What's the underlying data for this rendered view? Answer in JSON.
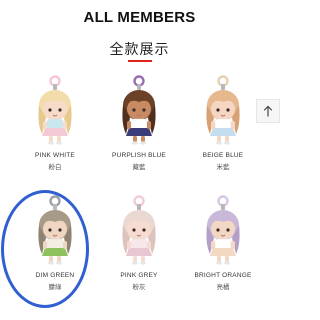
{
  "header": {
    "title": "ALL MEMBERS",
    "subtitle": "全款展示",
    "accent_color": "#e2231a"
  },
  "scroll_top": {
    "icon": "arrow-up-icon"
  },
  "members": [
    {
      "name": "PINK WHITE",
      "cn": "粉白",
      "hair": "#f2dca9",
      "hair_dark": "#e6c98d",
      "top": "#c9e7ee",
      "skirt": "#f4c9d6",
      "ring": "#f6c6d5",
      "skin": "#f6dcc8"
    },
    {
      "name": "PURPLISH BLUE",
      "cn": "藏藍",
      "hair": "#6b4128",
      "hair_dark": "#4f2e1b",
      "top": "#ffffff",
      "skirt": "#3b3d7a",
      "ring": "#9b6bb0",
      "skin": "#c88a62"
    },
    {
      "name": "BEIGE BLUE",
      "cn": "米藍",
      "hair": "#e6b88e",
      "hair_dark": "#d7a173",
      "top": "#ffffff",
      "skirt": "#c6dcef",
      "ring": "#e7d1b2",
      "skin": "#f4d6c2"
    },
    {
      "name": "DIM GREEN",
      "cn": "朦綠",
      "hair": "#a79a86",
      "hair_dark": "#8e8270",
      "top": "#f3efe0",
      "skirt": "#8fc25a",
      "ring": "#9aa0a6",
      "skin": "#efd6c2"
    },
    {
      "name": "PINK GREY",
      "cn": "粉灰",
      "hair": "#ead8d3",
      "hair_dark": "#dcc3bd",
      "top": "#f7e6ea",
      "skirt": "#e9c7d2",
      "ring": "#f2cbd6",
      "skin": "#f6dcd0"
    },
    {
      "name": "BRIGHT ORANGE",
      "cn": "亮橘",
      "hair": "#c9b8d8",
      "hair_dark": "#b3a0c6",
      "top": "#ffffff",
      "skirt": "#f3d9c2",
      "ring": "#d7c6e6",
      "skin": "#f3d7c5"
    }
  ]
}
